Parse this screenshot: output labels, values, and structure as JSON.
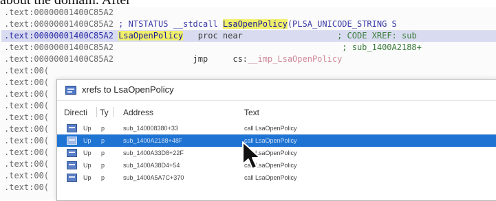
{
  "caption": "about the domain. After",
  "disasm": {
    "lines": [
      {
        "addr": ".text:00000001400C85A2",
        "rest": ""
      },
      {
        "addr": ".text:00000001400C85A2",
        "pre": " ; NTSTATUS __stdcall ",
        "fn": "LsaOpenPolicy",
        "post": "(PLSA_UNICODE_STRING S"
      },
      {
        "addr": ".text:00000001400C85A2",
        "name": "LsaOpenPolicy",
        "mid": "   proc near",
        "comment": "                   ; CODE XREF: sub"
      },
      {
        "addr": ".text:00000001400C85A2",
        "comment": "                                              ; sub_1400A2188+"
      },
      {
        "addr": ".text:00000001400C85A2",
        "mid": "                jmp     cs:",
        "imp": "__imp_LsaOpenPolicy"
      },
      {
        "addr": ".text:00(",
        "rest": ""
      },
      {
        "addr": ".text:00(",
        "rest": ""
      },
      {
        "addr": ".text:00(",
        "rest": ""
      },
      {
        "addr": ".text:00(",
        "rest": ""
      },
      {
        "addr": ".text:00(",
        "rest": ""
      },
      {
        "addr": ".text:00(",
        "rest": ""
      },
      {
        "addr": ".text:00(",
        "rest": ""
      },
      {
        "addr": ".text:00(",
        "rest": ""
      },
      {
        "addr": ".text:00(",
        "rest": ""
      },
      {
        "addr": ".text:00(",
        "rest": ""
      },
      {
        "addr": ".text:00(",
        "rest": ""
      }
    ]
  },
  "dialog": {
    "title": "xrefs to LsaOpenPolicy",
    "columns": [
      "Directi",
      "Ty",
      "Address",
      "Text"
    ],
    "rows": [
      {
        "direction": "Up",
        "type": "p",
        "address": "sub_140008380+33",
        "text": "call    LsaOpenPolicy"
      },
      {
        "direction": "Up",
        "type": "p",
        "address": "sub_1400A2188+48F",
        "text": "call    LsaOpenPolicy"
      },
      {
        "direction": "Up",
        "type": "p",
        "address": "sub_1400A33D8+22F",
        "text": "call    LsaOpenPolicy"
      },
      {
        "direction": "Up",
        "type": "p",
        "address": "sub_1400A38D4+54",
        "text": "call    LsaOpenPolicy"
      },
      {
        "direction": "Up",
        "type": "p",
        "address": "sub_1400A5A7C+370",
        "text": "call    LsaOpenPolicy"
      }
    ],
    "selected_row": 1
  },
  "icons": {
    "title": "xrefs-window-icon",
    "row": "xref-row-icon",
    "cursor": "mouse-pointer-icon"
  },
  "colors": {
    "selection": "#1f73d2",
    "highlight": "#f1f06a",
    "selected_line": "#d9dcf0"
  }
}
